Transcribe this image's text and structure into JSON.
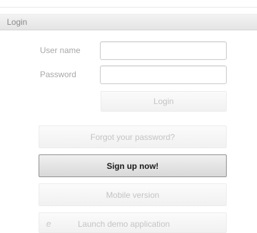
{
  "panel": {
    "title": "Login"
  },
  "form": {
    "username_label": "User name",
    "username_value": "",
    "password_label": "Password",
    "password_value": "",
    "login_label": "Login"
  },
  "actions": {
    "forgot_label": "Forgot your password?",
    "signup_label": "Sign up now!",
    "mobile_label": "Mobile version",
    "demo_label": "Launch demo application",
    "demo_icon": "internet-explorer-icon"
  }
}
